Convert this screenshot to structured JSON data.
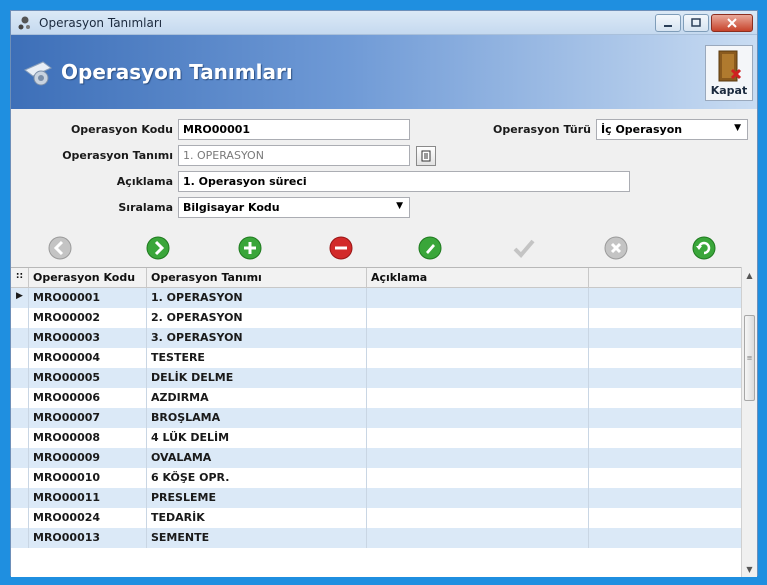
{
  "window": {
    "title": "Operasyon Tanımları"
  },
  "banner": {
    "title": "Operasyon Tanımları",
    "close_label": "Kapat"
  },
  "form": {
    "kod_label": "Operasyon Kodu",
    "kod_value": "MRO00001",
    "tanim_label": "Operasyon Tanımı",
    "tanim_value": "1. OPERASYON",
    "aciklama_label": "Açıklama",
    "aciklama_value": "1. Operasyon süreci",
    "siralama_label": "Sıralama",
    "siralama_value": "Bilgisayar Kodu",
    "tur_label": "Operasyon Türü",
    "tur_value": "İç Operasyon"
  },
  "toolbar": {
    "icons": [
      "prev-icon",
      "next-icon",
      "add-icon",
      "delete-icon",
      "edit-icon",
      "save-check-icon",
      "cancel-icon",
      "refresh-icon"
    ],
    "colors": {
      "green": "#3aa63a",
      "red": "#d22a2a",
      "gray": "#b9b9b9"
    }
  },
  "grid": {
    "columns": [
      "Operasyon Kodu",
      "Operasyon Tanımı",
      "Açıklama"
    ],
    "rows": [
      [
        "MRO00001",
        "1. OPERASYON",
        ""
      ],
      [
        "MRO00002",
        "2. OPERASYON",
        ""
      ],
      [
        "MRO00003",
        "3. OPERASYON",
        ""
      ],
      [
        "MRO00004",
        "TESTERE",
        ""
      ],
      [
        "MRO00005",
        "DELİK DELME",
        ""
      ],
      [
        "MRO00006",
        "AZDIRMA",
        ""
      ],
      [
        "MRO00007",
        "BROŞLAMA",
        ""
      ],
      [
        "MRO00008",
        "4 LÜK DELİM",
        ""
      ],
      [
        "MRO00009",
        "OVALAMA",
        ""
      ],
      [
        "MRO00010",
        "6 KÖŞE OPR.",
        ""
      ],
      [
        "MRO00011",
        "PRESLEME",
        ""
      ],
      [
        "MRO00024",
        "TEDARİK",
        ""
      ],
      [
        "MRO00013",
        "SEMENTE",
        ""
      ]
    ]
  }
}
